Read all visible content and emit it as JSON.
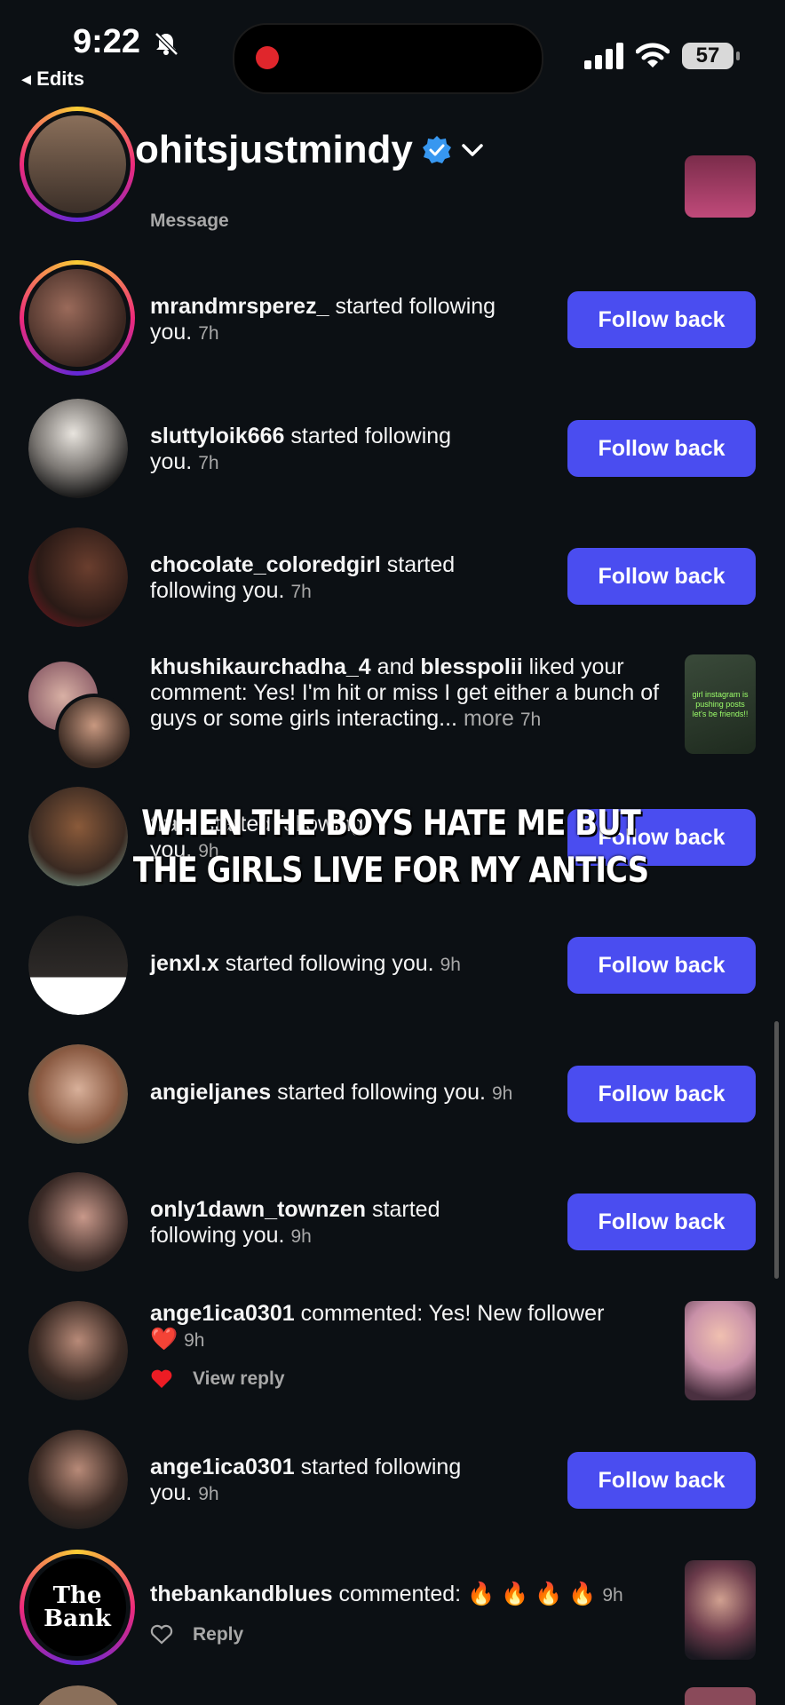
{
  "status_bar": {
    "time": "9:22",
    "back_app": "◂ Edits",
    "battery": "57"
  },
  "header": {
    "username": "ohitsjustmindy"
  },
  "partial_top": {
    "message_label": "Message"
  },
  "notifications": [
    {
      "username": "mrandmrsperez_",
      "action": "started following",
      "action2": "you.",
      "time": "7h",
      "button": "Follow back"
    },
    {
      "username": "sluttyloik666",
      "action": "started following",
      "action2": "you.",
      "time": "7h",
      "button": "Follow back"
    },
    {
      "username": "chocolate_coloredgirl",
      "action": "started",
      "action2": "following you.",
      "time": "7h",
      "button": "Follow back"
    },
    {
      "username": "khushikaurchadha_4",
      "and": "and",
      "username2": "blesspolii",
      "action": "liked your comment: Yes! I'm hit or miss I get either a bunch of guys or some girls interacting...",
      "more": "more",
      "time": "7h"
    },
    {
      "username": "tra...",
      "action": "started following",
      "action2": "you.",
      "time": "9h",
      "button": "Follow back"
    },
    {
      "username": "jenxl.x",
      "action": "started following you.",
      "time": "9h",
      "button": "Follow back"
    },
    {
      "username": "angieljanes",
      "action": "started following you.",
      "time": "9h",
      "button": "Follow back"
    },
    {
      "username": "only1dawn_townzen",
      "action": "started",
      "action2": "following you.",
      "time": "9h",
      "button": "Follow back"
    },
    {
      "username": "ange1ica0301",
      "action": "commented: Yes! New follower",
      "emoji": "❤️",
      "time": "9h",
      "sub_action": "View reply"
    },
    {
      "username": "ange1ica0301",
      "action": "started following",
      "action2": "you.",
      "time": "9h",
      "button": "Follow back"
    },
    {
      "username": "thebankandblues",
      "action": "commented:",
      "emoji": "🔥 🔥 🔥 🔥",
      "time": "9h",
      "sub_action": "Reply",
      "avatar_text": "The Bank"
    }
  ],
  "overlay_caption": "WHEN THE BOYS HATE ME BUT THE GIRLS LIVE FOR MY ANTICS",
  "thumb_text": "girl instagram is pushing posts let's be friends!!",
  "colors": {
    "background": "#0c1014",
    "follow_button": "#4a4df0",
    "verified": "#3797f0"
  }
}
